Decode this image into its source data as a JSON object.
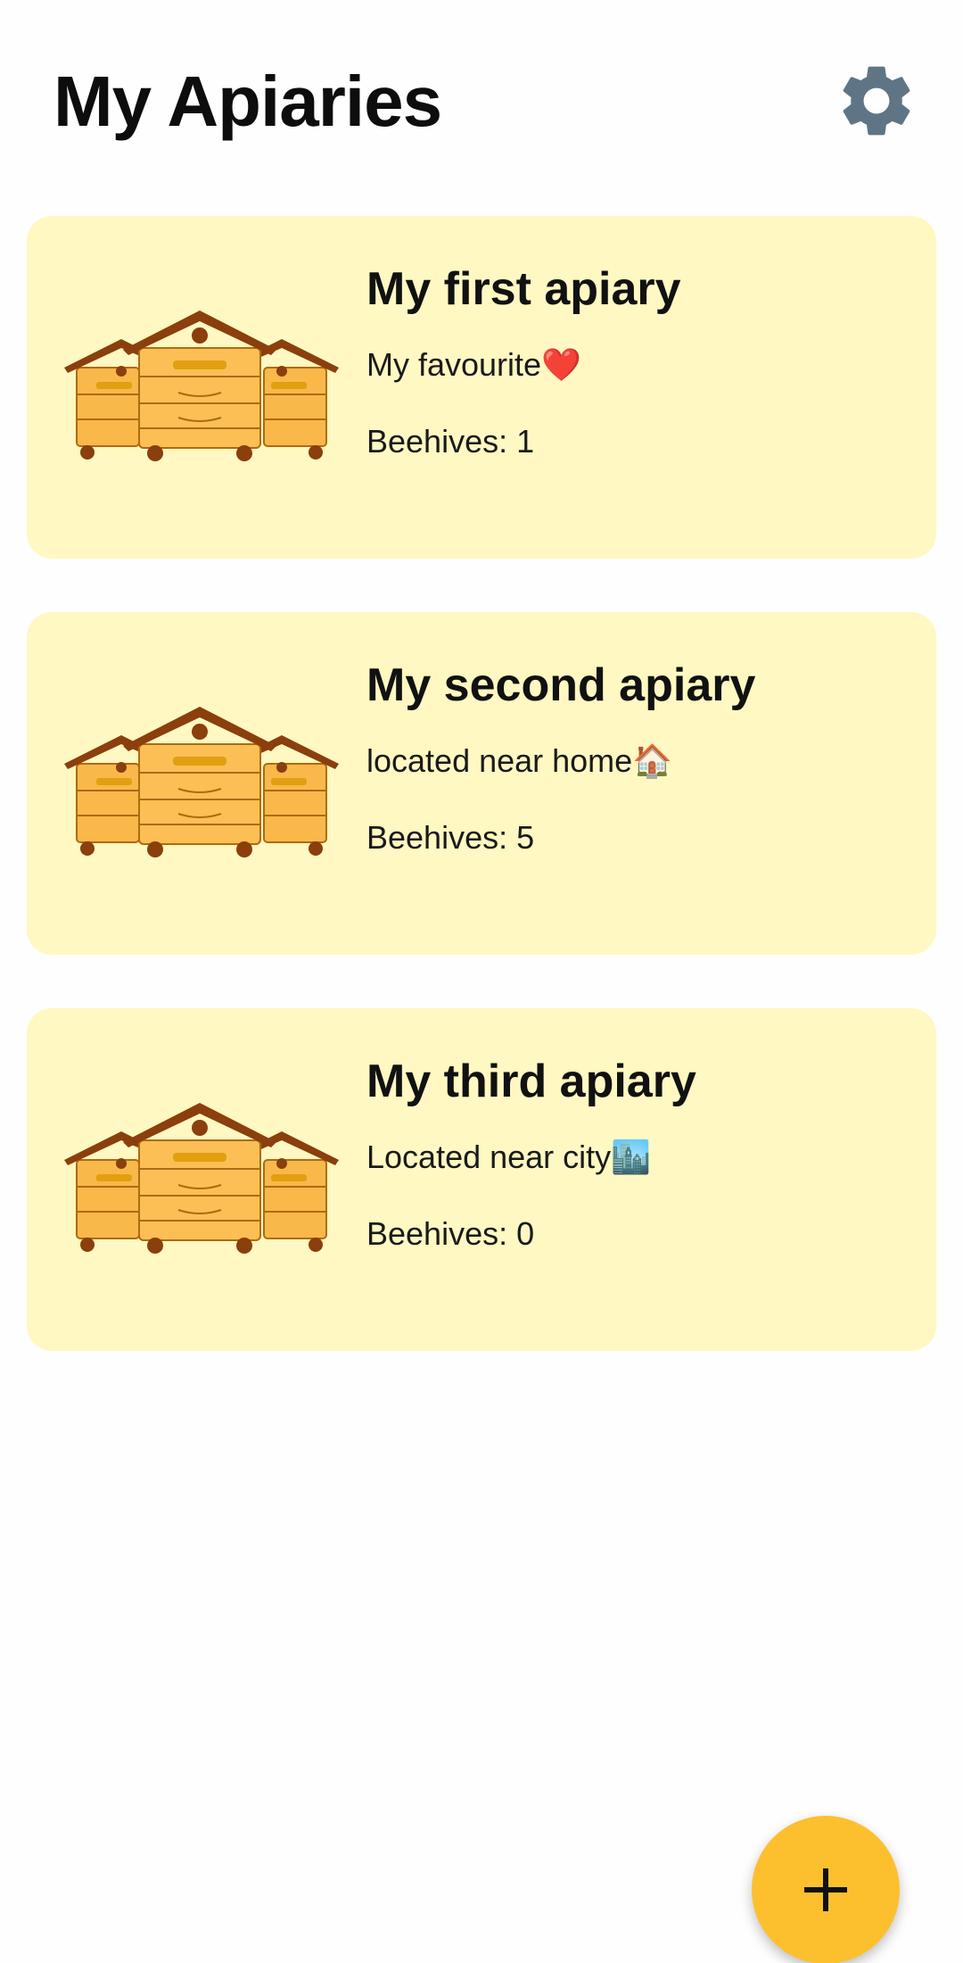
{
  "header": {
    "title": "My Apiaries",
    "settings_icon": "gear-icon",
    "settings_color": "#5f7585"
  },
  "apiaries": [
    {
      "name": "My first apiary",
      "description": "My favourite❤️",
      "beehives_label": "Beehives:",
      "beehives_count": "1"
    },
    {
      "name": "My second apiary",
      "description": "located near home🏠",
      "beehives_label": "Beehives:",
      "beehives_count": "5"
    },
    {
      "name": "My third apiary",
      "description": "Located near city🏙️",
      "beehives_label": "Beehives:",
      "beehives_count": "0"
    }
  ],
  "fab": {
    "icon": "plus-icon",
    "color": "#fcc02e"
  },
  "colors": {
    "card_background": "#fff8c2",
    "hive_body": "#f9b84a",
    "hive_roof": "#8a3f0c"
  }
}
